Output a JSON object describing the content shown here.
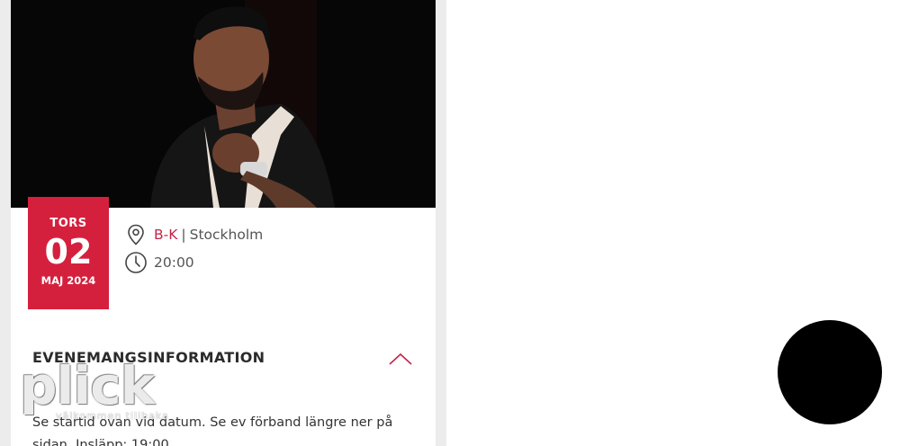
{
  "event": {
    "date": {
      "weekday": "TORS",
      "day": "02",
      "month_year": "MAJ 2024"
    },
    "venue": "B-K",
    "separator": "|",
    "city": "Stockholm",
    "time": "20:00"
  },
  "info_section": {
    "title": "EVENEMANGSINFORMATION",
    "description": "Se startid ovan vid datum. Se ev förband längre ner på sidan. Insläpp: 19:00"
  },
  "watermark": {
    "main": "plick",
    "sub": "välkommen tillbaka"
  },
  "icons": {
    "location": "map-pin-icon",
    "time": "clock-icon",
    "collapse": "chevron-up-icon"
  },
  "colors": {
    "accent": "#d5203d",
    "venue_link": "#c4244a",
    "background": "#ffffff"
  }
}
